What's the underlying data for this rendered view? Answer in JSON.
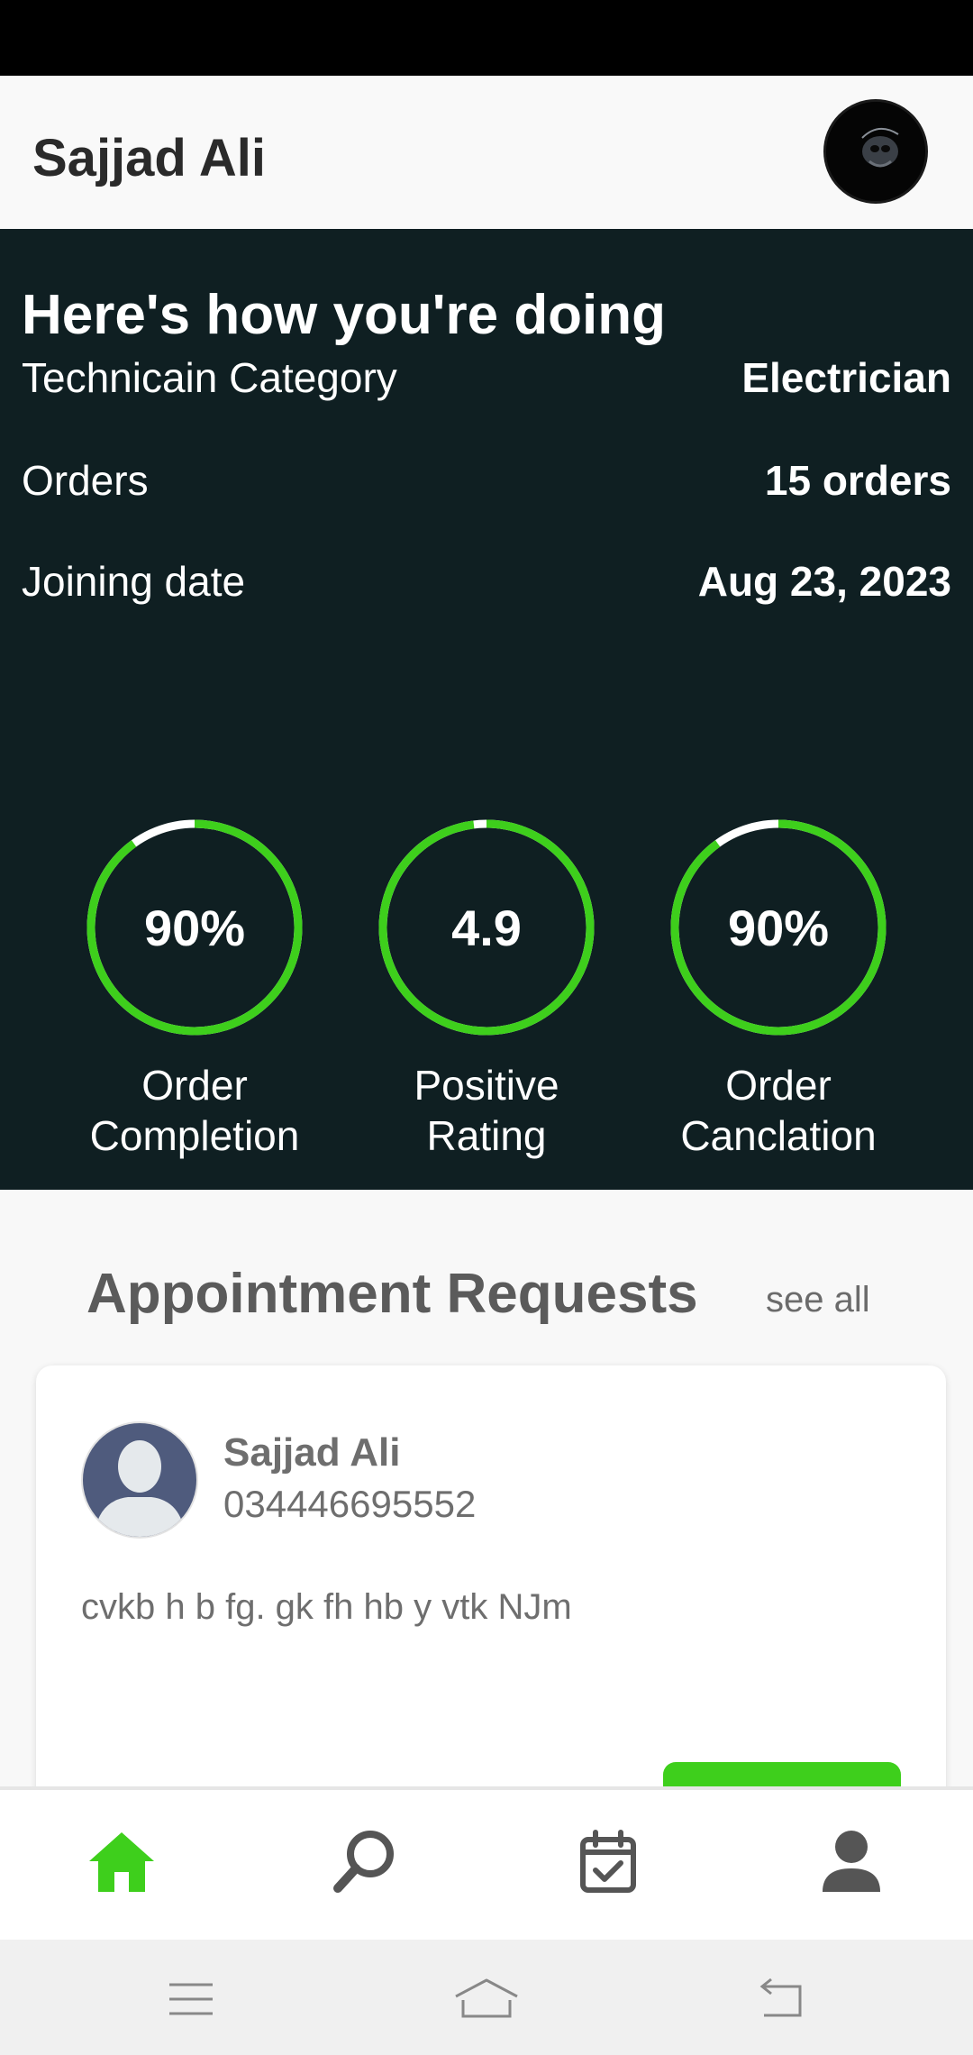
{
  "header": {
    "user_name": "Sajjad Ali"
  },
  "stats": {
    "heading": "Here's how you're doing",
    "rows": [
      {
        "label": "Technicain Category",
        "value": "Electrician"
      },
      {
        "label": "Orders",
        "value": "15 orders"
      },
      {
        "label": "Joining date",
        "value": "Aug 23, 2023"
      }
    ],
    "metrics": [
      {
        "value": "90%",
        "label_line1": "Order",
        "label_line2": "Completion",
        "progress": 0.9
      },
      {
        "value": "4.9",
        "label_line1": "Positive",
        "label_line2": "Rating",
        "progress": 0.98
      },
      {
        "value": "90%",
        "label_line1": "Order",
        "label_line2": "Canclation",
        "progress": 0.9
      }
    ]
  },
  "appointments": {
    "title": "Appointment Requests",
    "see_all": "see all",
    "card": {
      "name": "Sajjad Ali",
      "phone": "034446695552",
      "description": "cvkb h b fg. gk fh hb y vtk NJm"
    }
  },
  "colors": {
    "accent": "#3ecf1c",
    "panel_bg": "#0f1f22",
    "ring_track": "#ffffff"
  },
  "nav": {
    "items": [
      "home-icon",
      "search-icon",
      "calendar-check-icon",
      "profile-icon"
    ],
    "active": "home-icon"
  }
}
